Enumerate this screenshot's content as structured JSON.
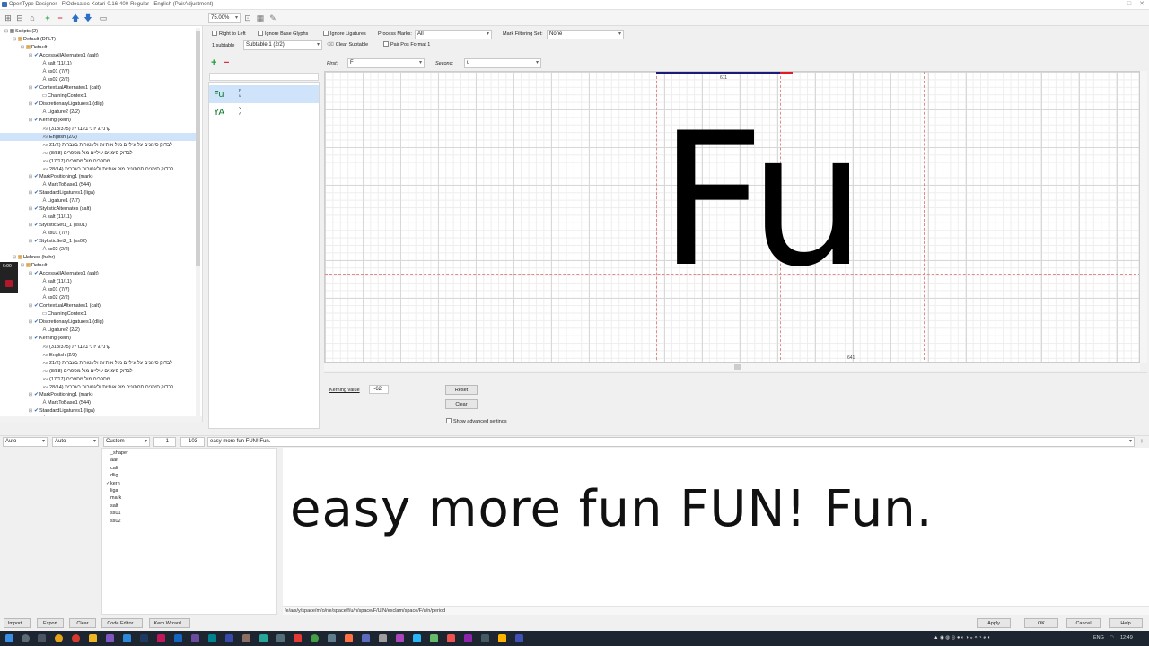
{
  "window": {
    "title": "OpenType Designer - FtOdecatec-Kotari-0.16-400-Regular - English (PairAdjustment)",
    "controls": [
      "–",
      "□",
      "✕"
    ]
  },
  "toolbar": {
    "zoom": "75.00%",
    "icons": [
      "folder-icon",
      "save-icon",
      "building-icon",
      "add-icon",
      "remove-icon",
      "up-arrow-icon",
      "down-arrow-icon",
      "preview-icon"
    ]
  },
  "tree": {
    "nodes": [
      {
        "label": "Scripts (2)",
        "depth": 0,
        "icon": "tw",
        "sel": false
      },
      {
        "label": "Default (DFLT)",
        "depth": 1,
        "icon": "fld",
        "sel": false
      },
      {
        "label": "Default",
        "depth": 2,
        "icon": "fld",
        "sel": false
      },
      {
        "label": "AccessAllAlternates1 (aalt)",
        "depth": 3,
        "icon": "chk",
        "sel": false
      },
      {
        "label": "salt (11/11)",
        "depth": 4,
        "icon": "glyph",
        "sel": false
      },
      {
        "label": "ss01 (7/7)",
        "depth": 4,
        "icon": "glyph",
        "sel": false
      },
      {
        "label": "ss02 (2/2)",
        "depth": 4,
        "icon": "glyph",
        "sel": false
      },
      {
        "label": "ContextualAlternates1 (calt)",
        "depth": 3,
        "icon": "chk",
        "sel": false
      },
      {
        "label": "ChainingContext1",
        "depth": 4,
        "icon": "ctx",
        "sel": false
      },
      {
        "label": "DiscretionaryLigatures1 (dlig)",
        "depth": 3,
        "icon": "chk",
        "sel": false
      },
      {
        "label": "Ligature2 (2/2)",
        "depth": 4,
        "icon": "glyph",
        "sel": false
      },
      {
        "label": "Kerning (kern)",
        "depth": 3,
        "icon": "chk",
        "sel": false
      },
      {
        "label": "קרנינג ידני בעברית (313/375)",
        "depth": 4,
        "icon": "kern",
        "sel": false
      },
      {
        "label": "English (2/2)",
        "depth": 4,
        "icon": "kern",
        "sel": true
      },
      {
        "label": "לבדוק סימנים על עיליים מול אותיות וליגטורות בעברית (21/2",
        "depth": 4,
        "icon": "kern",
        "sel": false
      },
      {
        "label": "לבדוק סימנים עיליים מול מספרים (8/88)",
        "depth": 4,
        "icon": "kern",
        "sel": false
      },
      {
        "label": "מספרים מול מספרים (17/17)",
        "depth": 4,
        "icon": "kern",
        "sel": false
      },
      {
        "label": "לבדוק סימנים תחתונים מול אותיות וליגטורות בעברית (28/14",
        "depth": 4,
        "icon": "kern",
        "sel": false
      },
      {
        "label": "MarkPositioning1 (mark)",
        "depth": 3,
        "icon": "chk",
        "sel": false
      },
      {
        "label": "MarkToBase1 (544)",
        "depth": 4,
        "icon": "glyph",
        "sel": false
      },
      {
        "label": "StandardLigatures1 (liga)",
        "depth": 3,
        "icon": "chk",
        "sel": false
      },
      {
        "label": "Ligature1 (7/7)",
        "depth": 4,
        "icon": "glyph",
        "sel": false
      },
      {
        "label": "StylisticAlternates (salt)",
        "depth": 3,
        "icon": "chk",
        "sel": false
      },
      {
        "label": "salt (11/11)",
        "depth": 4,
        "icon": "glyph",
        "sel": false
      },
      {
        "label": "StylisticSet1_1 (ss01)",
        "depth": 3,
        "icon": "chk",
        "sel": false
      },
      {
        "label": "ss01 (7/7)",
        "depth": 4,
        "icon": "glyph",
        "sel": false
      },
      {
        "label": "StylisticSet2_1 (ss02)",
        "depth": 3,
        "icon": "chk",
        "sel": false
      },
      {
        "label": "ss02 (2/2)",
        "depth": 4,
        "icon": "glyph",
        "sel": false
      },
      {
        "label": "Hebrew (hebr)",
        "depth": 1,
        "icon": "fld",
        "sel": false
      },
      {
        "label": "Default",
        "depth": 2,
        "icon": "fld",
        "sel": false
      },
      {
        "label": "AccessAllAlternates1 (aalt)",
        "depth": 3,
        "icon": "chk",
        "sel": false
      },
      {
        "label": "salt (11/11)",
        "depth": 4,
        "icon": "glyph",
        "sel": false
      },
      {
        "label": "ss01 (7/7)",
        "depth": 4,
        "icon": "glyph",
        "sel": false
      },
      {
        "label": "ss02 (2/2)",
        "depth": 4,
        "icon": "glyph",
        "sel": false
      },
      {
        "label": "ContextualAlternates1 (calt)",
        "depth": 3,
        "icon": "chk",
        "sel": false
      },
      {
        "label": "ChainingContext1",
        "depth": 4,
        "icon": "ctx",
        "sel": false
      },
      {
        "label": "DiscretionaryLigatures1 (dlig)",
        "depth": 3,
        "icon": "chk",
        "sel": false
      },
      {
        "label": "Ligature2 (2/2)",
        "depth": 4,
        "icon": "glyph",
        "sel": false
      },
      {
        "label": "Kerning (kern)",
        "depth": 3,
        "icon": "chk",
        "sel": false
      },
      {
        "label": "קרנינג ידני בעברית (313/375)",
        "depth": 4,
        "icon": "kern",
        "sel": false
      },
      {
        "label": "English (2/2)",
        "depth": 4,
        "icon": "kern",
        "sel": false
      },
      {
        "label": "לבדוק סימנים על עיליים מול אותיות וליגטורות בעברית (21/2",
        "depth": 4,
        "icon": "kern",
        "sel": false
      },
      {
        "label": "לבדוק סימנים עיליים מול מספרים (8/88)",
        "depth": 4,
        "icon": "kern",
        "sel": false
      },
      {
        "label": "מספרים מול מספרים (17/17)",
        "depth": 4,
        "icon": "kern",
        "sel": false
      },
      {
        "label": "לבדוק סימנים תחתונים מול אותיות וליגטורות בעברית (28/14",
        "depth": 4,
        "icon": "kern",
        "sel": false
      },
      {
        "label": "MarkPositioning1 (mark)",
        "depth": 3,
        "icon": "chk",
        "sel": false
      },
      {
        "label": "MarkToBase1 (544)",
        "depth": 4,
        "icon": "glyph",
        "sel": false
      },
      {
        "label": "StandardLigatures1 (liga)",
        "depth": 3,
        "icon": "chk",
        "sel": false
      },
      {
        "label": "Ligature1 (7/7)",
        "depth": 4,
        "icon": "glyph",
        "sel": false
      }
    ]
  },
  "recorder": {
    "time": "6:00"
  },
  "options": {
    "right_to_left": "Right to Left",
    "ignore_base_glyphs": "Ignore Base Glyphs",
    "ignore_ligatures": "Ignore Ligatures",
    "process_marks_label": "Process Marks:",
    "process_marks_value": "All",
    "mark_filtering_label": "Mark Filtering Set:",
    "mark_filtering_value": "None",
    "subtable_count": "1 subtable",
    "subtable_value": "Subtable 1 (2/2)",
    "clear_subtable": "Clear Subtable",
    "pair_pos_format": "Pair Pos Format 1"
  },
  "pairs": [
    {
      "glyphs": "Fu",
      "first": "F",
      "second": "u"
    },
    {
      "glyphs": "YA",
      "first": "Y",
      "second": "A"
    }
  ],
  "selectors": {
    "first_label": "First:",
    "first_value": "F",
    "second_label": "Second:",
    "second_value": "u"
  },
  "canvas": {
    "glyph_text": "Fu",
    "top_metric": "611",
    "bottom_metric": "641",
    "colors": {
      "metric_bar": "#1a1a7a",
      "metric_red": "#e0192b"
    }
  },
  "kerning": {
    "label": "Kerning value",
    "value": "-62",
    "reset": "Reset",
    "clear": "Clear",
    "advanced": "Show advanced settings"
  },
  "preview_controls": {
    "dir_value": "Auto",
    "script_value": "Auto",
    "lang_value": "Custom",
    "num_value": "1",
    "size_value": "103",
    "text_value": "easy more fun FUN! Fun."
  },
  "features": [
    {
      "tag": "_shaper",
      "checked": false
    },
    {
      "tag": "aalt",
      "checked": false
    },
    {
      "tag": "calt",
      "checked": false
    },
    {
      "tag": "dlig",
      "checked": false
    },
    {
      "tag": "kern",
      "checked": true
    },
    {
      "tag": "liga",
      "checked": false
    },
    {
      "tag": "mark",
      "checked": false
    },
    {
      "tag": "salt",
      "checked": false
    },
    {
      "tag": "ss01",
      "checked": false
    },
    {
      "tag": "ss02",
      "checked": false
    }
  ],
  "preview": {
    "text": "easy more fun FUN! Fun.",
    "glyph_stream": "/e/a/s/y/space/m/o/r/e/space/f/u/n/space/F/U/N/exclam/space/F/u/n/period"
  },
  "bottom": {
    "import": "Import...",
    "export": "Export",
    "clear": "Clear",
    "code_editor": "Code Editor...",
    "kern_wizard": "Kern Wizard...",
    "apply": "Apply",
    "ok": "OK",
    "cancel": "Cancel",
    "help": "Help"
  },
  "taskbar": {
    "lang": "ENG",
    "time": "12:49"
  }
}
